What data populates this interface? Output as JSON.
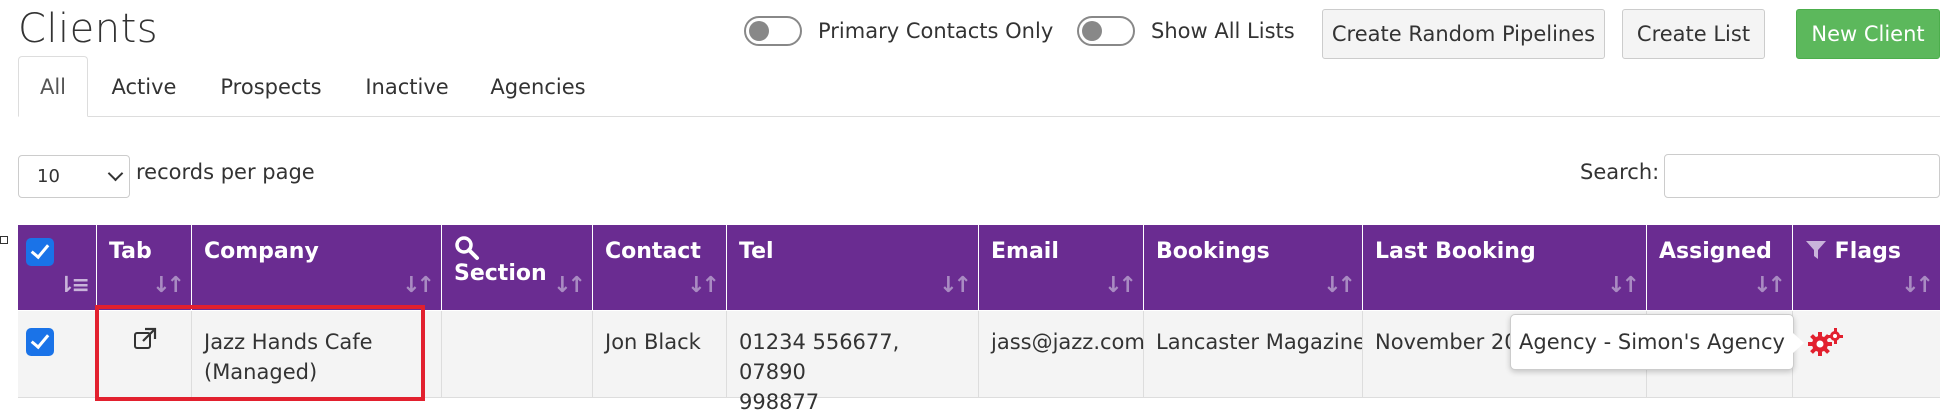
{
  "page": {
    "title": "Clients"
  },
  "toggles": [
    {
      "label": "Primary Contacts Only",
      "on": false
    },
    {
      "label": "Show All Lists",
      "on": false
    }
  ],
  "buttons": {
    "create_random_pipelines": "Create Random Pipelines",
    "create_list": "Create List",
    "new_client": "New Client"
  },
  "tabs": [
    {
      "label": "All",
      "active": true
    },
    {
      "label": "Active"
    },
    {
      "label": "Prospects"
    },
    {
      "label": "Inactive"
    },
    {
      "label": "Agencies"
    }
  ],
  "pagination": {
    "records_value": "10",
    "records_label": "records per page"
  },
  "search": {
    "label": "Search:",
    "placeholder": ""
  },
  "table": {
    "header_color": "#6a2c91",
    "columns": {
      "tab": "Tab",
      "company": "Company",
      "section": "Section",
      "contact": "Contact",
      "tel": "Tel",
      "email": "Email",
      "bookings": "Bookings",
      "last_booking": "Last Booking",
      "assigned": "Assigned",
      "flags": "Flags"
    },
    "rows": [
      {
        "checked": true,
        "company_line1": "Jazz Hands Cafe",
        "company_line2": "(Managed)",
        "section": "",
        "contact": "Jon Black",
        "tel_line1": "01234 556677, 07890",
        "tel_line2": "998877",
        "email": "jass@jazz.com",
        "bookings": "Lancaster Magazine",
        "last_booking": "November 20",
        "assigned": ""
      }
    ]
  },
  "tooltip": {
    "text": "Agency - Simon's Agency"
  },
  "icons": {
    "sort": "sort-icon",
    "search": "search-icon",
    "filter": "filter-icon",
    "external_link": "external-link-icon",
    "flags": "gears-icon"
  },
  "colors": {
    "accent_green": "#5cb85c",
    "checkbox_blue": "#1a73e8",
    "flag_red": "#e2202e",
    "highlight_red": "#e2202e"
  }
}
